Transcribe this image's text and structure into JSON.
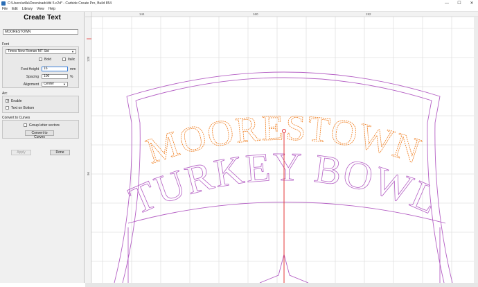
{
  "window": {
    "title": "C:\\Users\\willa\\Downloads\\tbl 5.c2d* - Carbide Create Pro, Build 854",
    "controls": [
      "—",
      "☐",
      "✕"
    ]
  },
  "menu": [
    "File",
    "Edit",
    "Library",
    "View",
    "Help"
  ],
  "panel": {
    "title": "Create Text",
    "text_value": "MOORESTOWN",
    "font_section": "Font",
    "font_name": "Times New Roman MT Std",
    "bold_label": "Bold",
    "italic_label": "Italic",
    "font_height_label": "Font Height",
    "font_height_value": "16",
    "font_height_unit": "mm",
    "spacing_label": "Spacing",
    "spacing_value": "100",
    "spacing_unit": "%",
    "alignment_label": "Alignment",
    "alignment_value": "Center",
    "arc_section": "Arc",
    "enable_label": "Enable",
    "enable_checked": true,
    "bottom_label": "Text on Bottom",
    "convert_section": "Convert to Curves",
    "group_label": "Group letter vectors",
    "convert_button": "Convert to Curves",
    "apply_button": "Apply",
    "done_button": "Done"
  },
  "ruler": {
    "top_ticks": [
      "144",
      "160",
      "192"
    ],
    "left_ticks": [
      "128",
      "96"
    ]
  },
  "design": {
    "arc_text_top": "MOORESTOWN",
    "arc_text_bottom": "TURKEY BOWL"
  },
  "colors": {
    "selected_text": "#f07d1e",
    "vector": "#b45fc4",
    "origin_line": "#e53535",
    "grid": "#e1e1e1"
  }
}
